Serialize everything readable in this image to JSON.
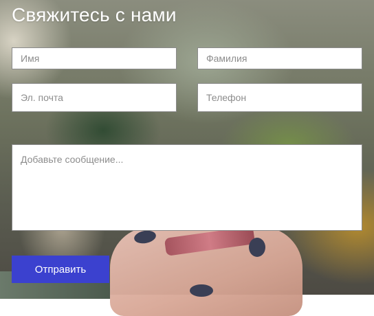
{
  "form": {
    "title": "Свяжитесь с нами",
    "fields": {
      "first_name": {
        "placeholder": "Имя",
        "value": ""
      },
      "last_name": {
        "placeholder": "Фамилия",
        "value": ""
      },
      "email": {
        "placeholder": "Эл. почта",
        "value": ""
      },
      "phone": {
        "placeholder": "Телефон",
        "value": ""
      },
      "message": {
        "placeholder": "Добавьте сообщение...",
        "value": ""
      }
    },
    "submit_label": "Отправить"
  },
  "colors": {
    "accent": "#3b41cf",
    "title_text": "#ffffff",
    "field_border": "#8a8a8a",
    "placeholder_text": "#8c8c8c"
  }
}
